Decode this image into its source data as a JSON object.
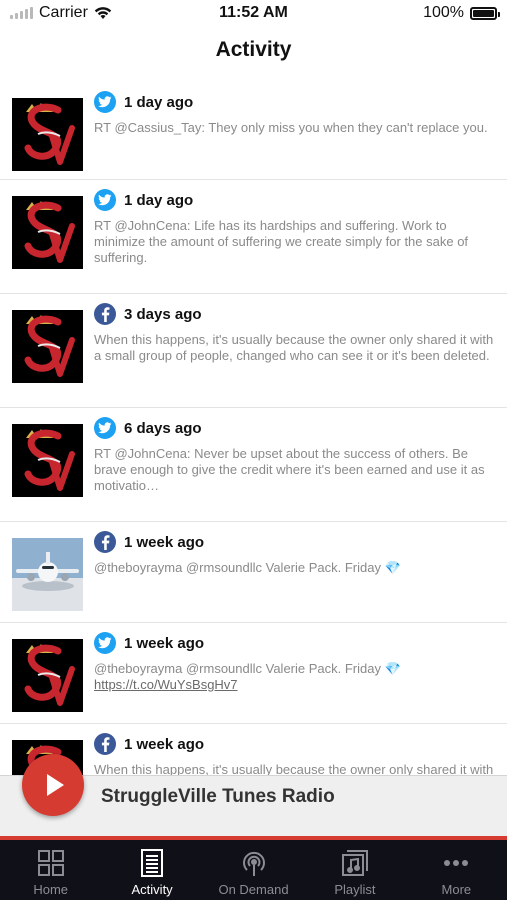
{
  "status_bar": {
    "carrier": "Carrier",
    "time": "11:52 AM",
    "battery": "100%"
  },
  "header": {
    "title": "Activity"
  },
  "feed": [
    {
      "network": "twitter",
      "network_icon": "twitter-icon",
      "thumb": "struggleville-logo",
      "ago": "1 day ago",
      "text": "RT @Cassius_Tay: They only miss you when they can't replace you."
    },
    {
      "network": "twitter",
      "network_icon": "twitter-icon",
      "thumb": "struggleville-logo",
      "ago": "1 day ago",
      "text": "RT @JohnCena: Life has its hardships and suffering. Work to minimize the amount of suffering we create simply for the sake of suffering."
    },
    {
      "network": "facebook",
      "network_icon": "facebook-icon",
      "thumb": "struggleville-logo",
      "ago": "3 days ago",
      "text": "When this happens, it's usually because the owner only shared it with a small group of people, changed who can see it or it's been deleted."
    },
    {
      "network": "twitter",
      "network_icon": "twitter-icon",
      "thumb": "struggleville-logo",
      "ago": "6 days ago",
      "text": "RT @JohnCena: Never be upset about the success of others. Be brave enough to give the credit where it's been earned and use it as motivatio…"
    },
    {
      "network": "facebook",
      "network_icon": "facebook-icon",
      "thumb": "airplane-photo",
      "ago": "1 week ago",
      "text": "@theboyrayma @rmsoundllc  Valerie Pack. Friday",
      "emoji": "💎"
    },
    {
      "network": "twitter",
      "network_icon": "twitter-icon",
      "thumb": "struggleville-logo",
      "ago": "1 week ago",
      "text": "@theboyrayma @rmsoundllc  Valerie Pack. Friday",
      "emoji": "💎",
      "link": "https://t.co/WuYsBsgHv7"
    },
    {
      "network": "facebook",
      "network_icon": "facebook-icon",
      "thumb": "struggleville-logo",
      "ago": "1 week ago",
      "text": "When this happens, it's usually because the owner only shared it with a small group of people, changed who can see it or it's been deleted."
    }
  ],
  "player": {
    "station_name": "StruggleVille Tunes Radio",
    "play_icon": "play-icon",
    "accent_color": "#d63b31"
  },
  "tabbar": {
    "tabs": [
      {
        "label": "Home",
        "icon": "home-grid-icon",
        "active": false
      },
      {
        "label": "Activity",
        "icon": "activity-list-icon",
        "active": true
      },
      {
        "label": "On Demand",
        "icon": "podcast-icon",
        "active": false
      },
      {
        "label": "Playlist",
        "icon": "playlist-icon",
        "active": false
      },
      {
        "label": "More",
        "icon": "more-dots-icon",
        "active": false
      }
    ]
  },
  "colors": {
    "twitter": "#1da1f2",
    "facebook": "#3b5998",
    "tabbar_bg": "#101019"
  }
}
